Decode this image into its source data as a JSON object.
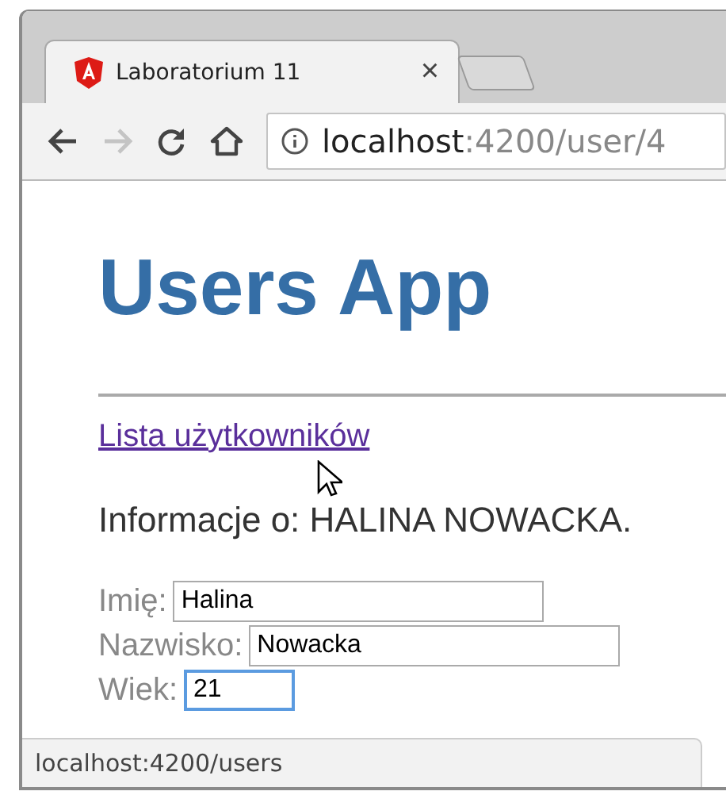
{
  "tab": {
    "title": "Laboratorium 11",
    "close": "×"
  },
  "toolbar": {
    "back_disabled": false,
    "forward_disabled": true,
    "url_host": "localhost",
    "url_path": ":4200/user/4"
  },
  "page": {
    "heading": "Users App",
    "link": "Lista użytkowników",
    "info": "Informacje o: HALINA NOWACKA.",
    "fields": [
      {
        "label": "Imię:",
        "value": "Halina",
        "kind": "text",
        "focused": false
      },
      {
        "label": "Nazwisko:",
        "value": "Nowacka",
        "kind": "text",
        "focused": false
      },
      {
        "label": "Wiek:",
        "value": "21",
        "kind": "number",
        "focused": true
      }
    ]
  },
  "status_bar": "localhost:4200/users"
}
